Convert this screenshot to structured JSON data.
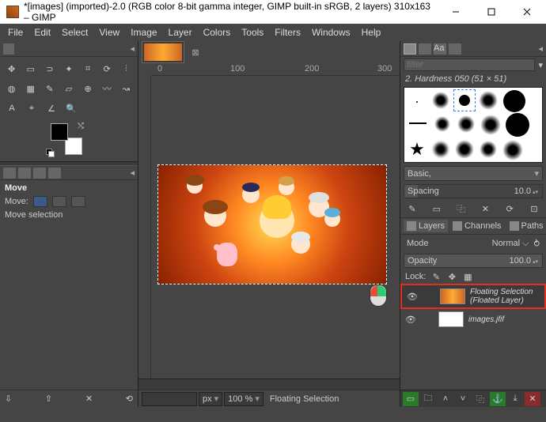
{
  "titlebar": {
    "title": "*[images] (imported)-2.0 (RGB color 8-bit gamma integer, GIMP built-in sRGB, 2 layers) 310x163 – GIMP"
  },
  "menubar": [
    "File",
    "Edit",
    "Select",
    "View",
    "Image",
    "Layer",
    "Colors",
    "Tools",
    "Filters",
    "Windows",
    "Help"
  ],
  "tool_options": {
    "header": "Move",
    "move_label": "Move:",
    "mode_label": "Move selection"
  },
  "ruler": {
    "t0": "0",
    "t100": "100",
    "t200": "200",
    "t300": "300"
  },
  "statusbar": {
    "unit": "px",
    "zoom": "100 %",
    "status": "Floating Selection"
  },
  "brushes": {
    "filter_placeholder": "filter",
    "selected": "2. Hardness 050 (51 × 51)",
    "preset": "Basic,",
    "spacing_label": "Spacing",
    "spacing_value": "10.0"
  },
  "layers": {
    "tabs": {
      "layers": "Layers",
      "channels": "Channels",
      "paths": "Paths"
    },
    "mode_label": "Mode",
    "mode_value": "Normal",
    "opacity_label": "Opacity",
    "opacity_value": "100.0",
    "lock_label": "Lock:",
    "items": [
      {
        "name": "Floating Selection\n(Floated Layer)"
      },
      {
        "name": "images.jfif"
      }
    ]
  }
}
